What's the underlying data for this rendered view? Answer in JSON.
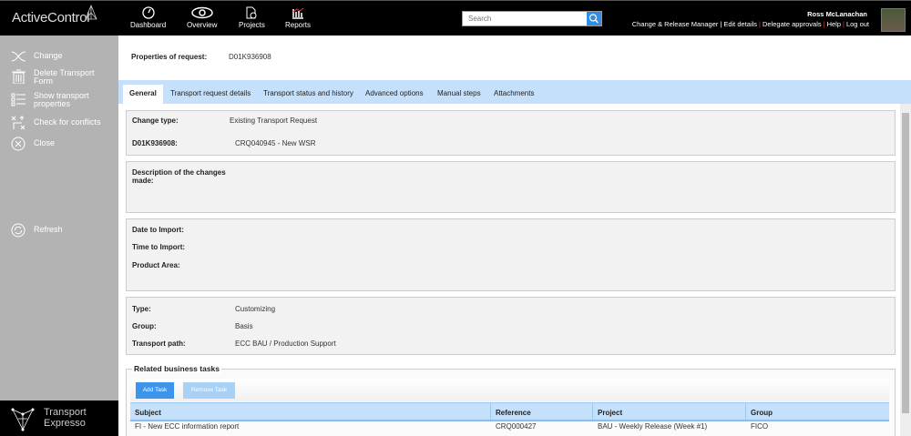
{
  "header": {
    "logo": "ActiveControl",
    "nav": [
      "Dashboard",
      "Overview",
      "Projects",
      "Reports"
    ],
    "search_placeholder": "Search",
    "user_name": "Ross McLanachan",
    "links": [
      "Change & Release Manager",
      "Edit details",
      "Delegate approvals",
      "Help",
      "Log out"
    ]
  },
  "sidebar": {
    "items": [
      "Change",
      "Delete Transport Form",
      "Show transport properties",
      "Check for conflicts",
      "Close",
      "Refresh"
    ],
    "brand_line1": "Transport",
    "brand_line2": "Expresso"
  },
  "main": {
    "properties_label": "Properties of request:",
    "request_id": "D01K936908",
    "tabs": [
      "General",
      "Transport request details",
      "Transport status and history",
      "Advanced options",
      "Manual steps",
      "Attachments"
    ],
    "fields": {
      "change_type_label": "Change type:",
      "change_type": "Existing Transport Request",
      "req_label": "D01K936908:",
      "req_value": "CRQ040945 - New WSR",
      "desc_label": "Description of the changes made:",
      "date_label": "Date to Import:",
      "time_label": "Time to Import:",
      "product_label": "Product Area:",
      "type_label": "Type:",
      "type": "Customizing",
      "group_label": "Group:",
      "group": "Basis",
      "path_label": "Transport path:",
      "path": "ECC BAU / Production Support"
    },
    "tasks": {
      "legend": "Related business tasks",
      "add": "Add Task",
      "remove": "Remove Task",
      "columns": [
        "Subject",
        "Reference",
        "Project",
        "Group"
      ],
      "rows": [
        [
          "FI - New ECC information report",
          "CRQ000427",
          "BAU - Weekly Release (Week #1)",
          "FICO"
        ]
      ]
    }
  }
}
